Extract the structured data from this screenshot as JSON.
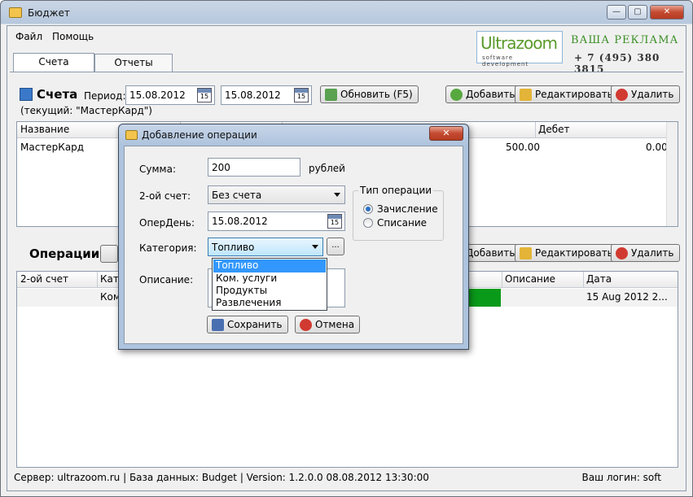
{
  "window": {
    "title": "Бюджет",
    "minimize": "—",
    "maximize": "▢",
    "close": "✕"
  },
  "menu": {
    "file": "Файл",
    "help": "Помощь"
  },
  "ad": {
    "logo": "Ultrazoom",
    "logo_sub": "software development",
    "title": "ВАША РЕКЛАМА",
    "phone": "+ 7 (495) 380 3815"
  },
  "tabs": [
    {
      "label": "Счета"
    },
    {
      "label": "Отчеты"
    }
  ],
  "accounts": {
    "title": "Счета",
    "period_label": "Период:",
    "date_from": "15.08.2012",
    "date_to": "15.08.2012",
    "calendar_day": "15",
    "refresh_label": "Обновить (F5)",
    "current": "(текущий: \"МастерКард\")",
    "add_label": "Добавить",
    "edit_label": "Редактировать",
    "delete_label": "Удалить",
    "columns": [
      "Название",
      "Дебет"
    ],
    "rows": [
      {
        "name": "МастерКард",
        "credit": "500.00",
        "debet": "0.00"
      }
    ]
  },
  "operations": {
    "title": "Операции",
    "add_label": "Добавить",
    "edit_label": "Редактировать",
    "delete_label": "Удалить",
    "columns": [
      "2-ой счет",
      "Кате",
      "Описание",
      "Дата"
    ],
    "row": {
      "category": "Ком",
      "date": "15 Aug 2012 2..."
    }
  },
  "dialog": {
    "title": "Добавление операции",
    "close": "✕",
    "sum_label": "Сумма:",
    "sum_value": "200",
    "currency": "рублей",
    "second_account_label": "2-ой счет:",
    "second_account_value": "Без счета",
    "opday_label": "ОперДень:",
    "opday_value": "15.08.2012",
    "calendar_day": "15",
    "category_label": "Категория:",
    "category_value": "Топливо",
    "browse": "...",
    "description_label": "Описание:",
    "op_type_title": "Тип операции",
    "op_type_income": "Зачисление",
    "op_type_expense": "Списание",
    "category_options": [
      "Топливо",
      "Ком. услуги",
      "Продукты",
      "Развлечения"
    ],
    "save_label": "Сохранить",
    "cancel_label": "Отмена"
  },
  "status": {
    "text": "Сервер: ultrazoom.ru  |  База данных: Budget  |  Version: 1.2.0.0 08.08.2012 13:30:00",
    "login": "Ваш логин: soft"
  }
}
